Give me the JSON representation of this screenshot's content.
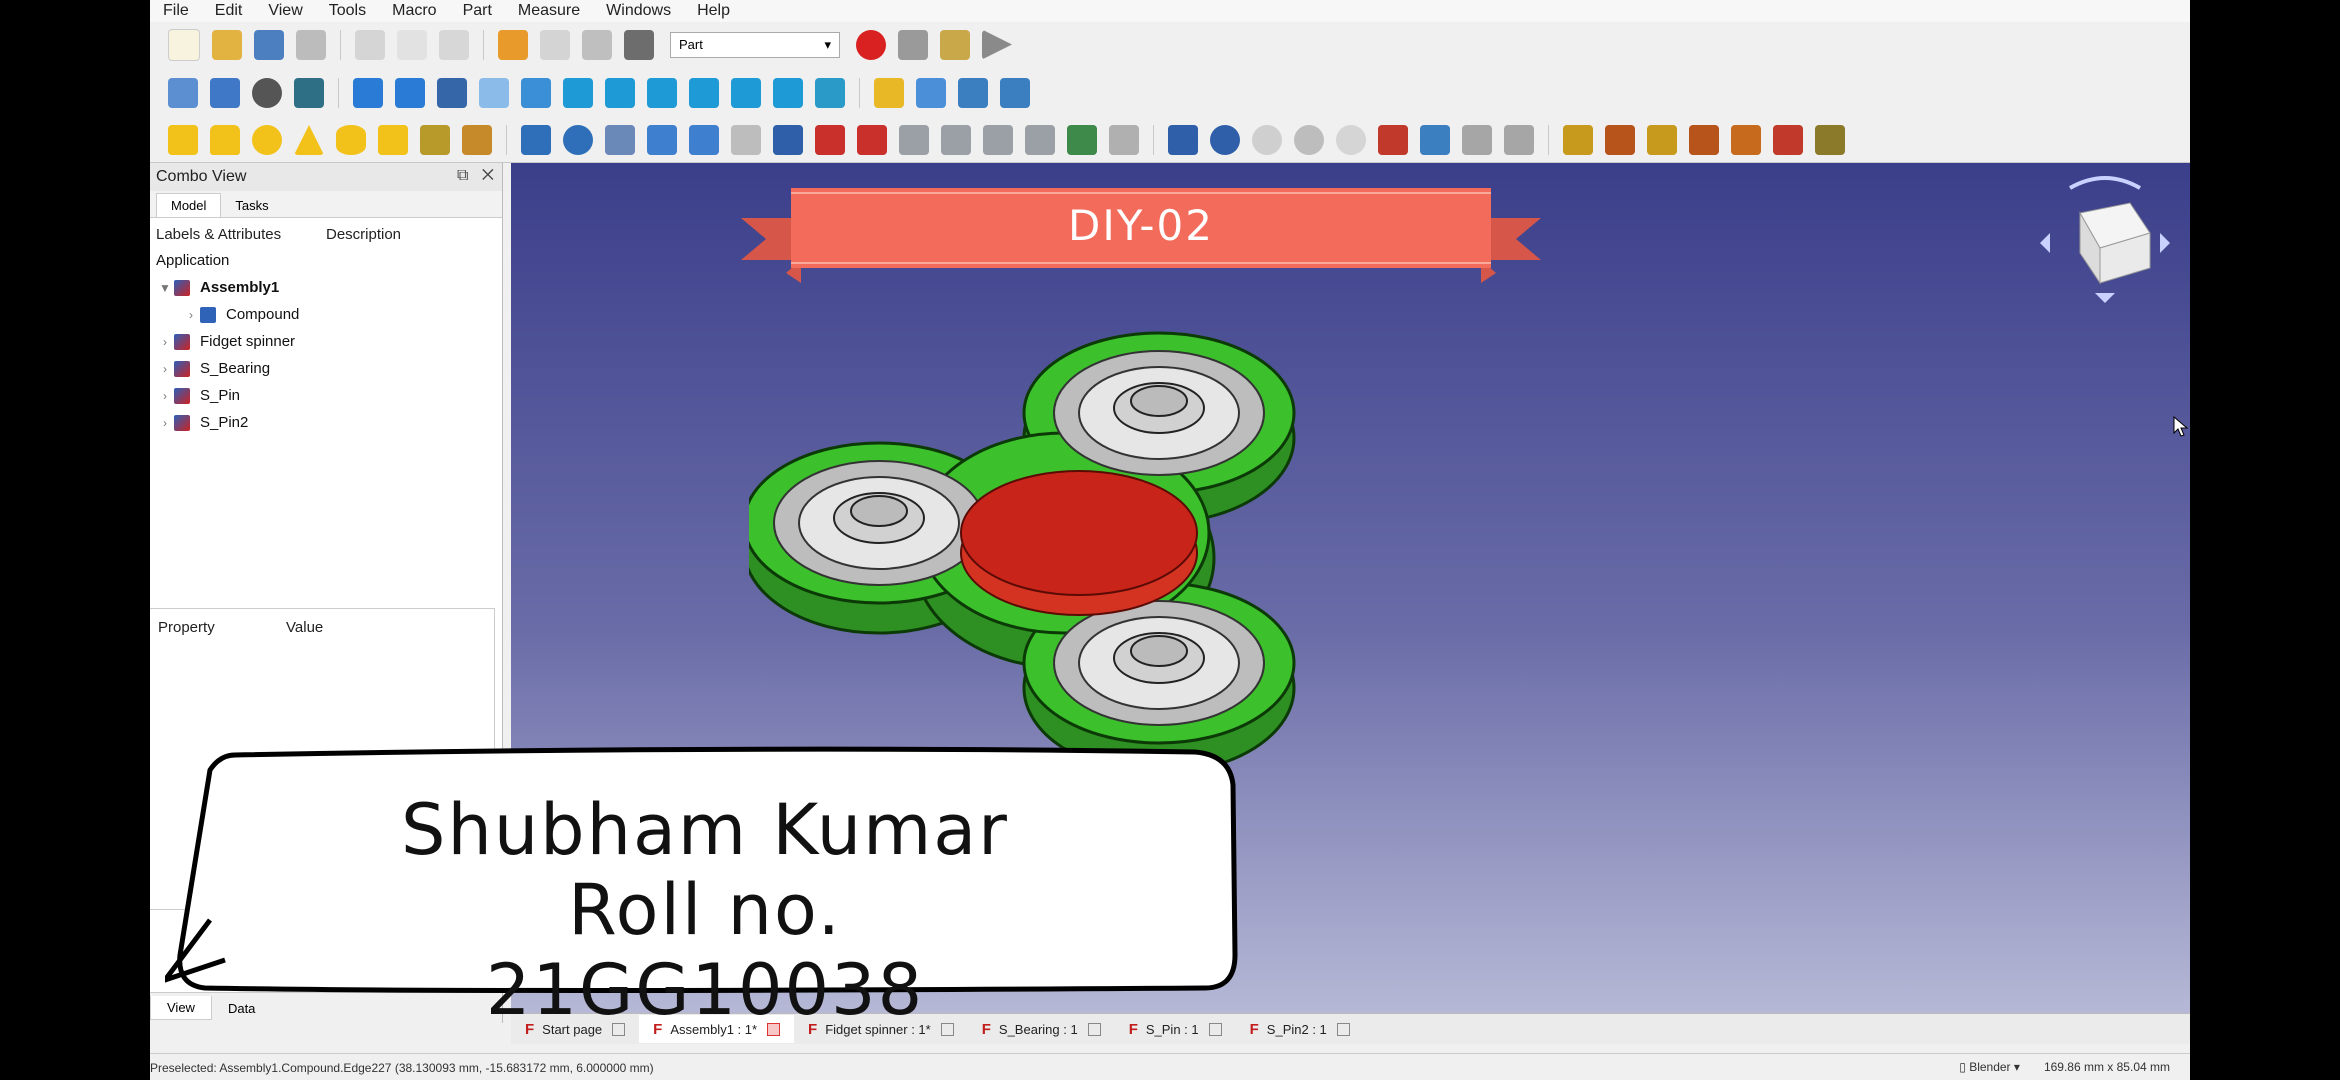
{
  "menu": [
    "File",
    "Edit",
    "View",
    "Tools",
    "Macro",
    "Part",
    "Measure",
    "Windows",
    "Help"
  ],
  "workbench": "Part",
  "combo": {
    "title": "Combo View",
    "tabs": [
      "Model",
      "Tasks"
    ],
    "col_labels": "Labels & Attributes",
    "col_description": "Description",
    "section": "Application",
    "tree": [
      {
        "label": "Assembly1",
        "expanded": true,
        "bold": true
      },
      {
        "label": "Compound",
        "child": true
      },
      {
        "label": "Fidget spinner"
      },
      {
        "label": "S_Bearing"
      },
      {
        "label": "S_Pin"
      },
      {
        "label": "S_Pin2"
      }
    ],
    "property_header": "Property",
    "value_header": "Value",
    "bottom_tabs": [
      "View",
      "Data"
    ]
  },
  "banner": {
    "text": "DIY-02",
    "color": "#f26b5b"
  },
  "overlay": {
    "line1": "Shubham Kumar",
    "line2": "Roll no. 21GG10038"
  },
  "doc_tabs": [
    {
      "label": "Start page",
      "active": false
    },
    {
      "label": "Assembly1 : 1*",
      "active": true
    },
    {
      "label": "Fidget spinner : 1*",
      "active": false
    },
    {
      "label": "S_Bearing : 1",
      "active": false
    },
    {
      "label": "S_Pin : 1",
      "active": false
    },
    {
      "label": "S_Pin2 : 1",
      "active": false
    }
  ],
  "status": {
    "left": "Preselected: Assembly1.Compound.Edge227 (38.130093 mm, -15.683172 mm, 6.000000 mm)",
    "nav_style": "Blender",
    "dimensions": "169.86 mm x 85.04 mm"
  },
  "colors": {
    "spinner": "#37b52a",
    "cap": "#c9241a",
    "bearing": "#c8c8c8"
  }
}
